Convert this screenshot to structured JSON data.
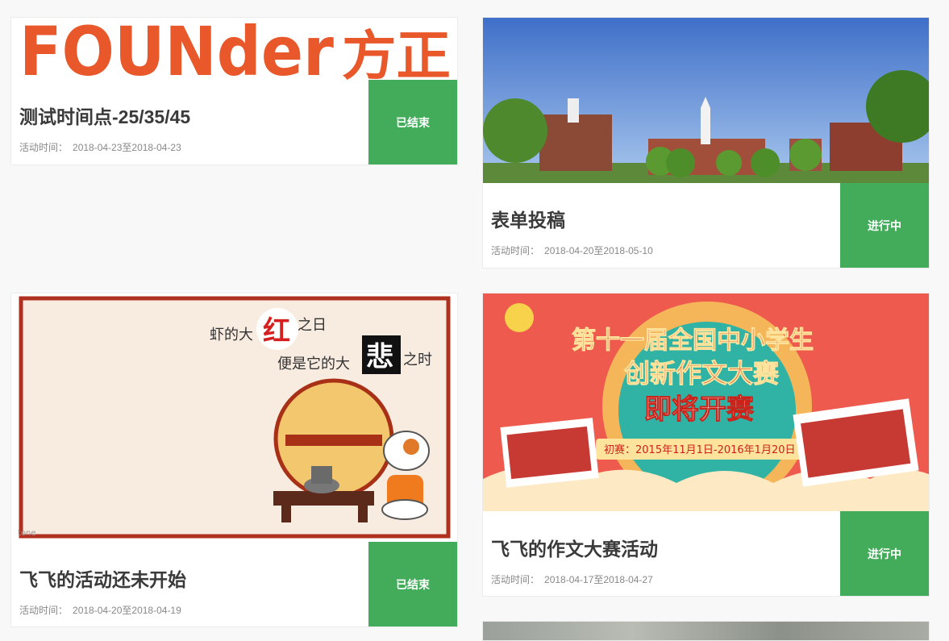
{
  "cards": [
    {
      "title": "测试时间点-25/35/45",
      "time_label": "活动时间：",
      "time_range": "2018-04-23至2018-04-23",
      "status": "已结束",
      "image": {
        "logo_text": "FOUNder",
        "logo_cn": "方正",
        "logo_color": "#e8582a"
      }
    },
    {
      "title": "表单投稿",
      "time_label": "活动时间：",
      "time_range": "2018-04-20至2018-05-10",
      "status": "进行中",
      "image": {
        "subject": "campus-panorama-icon"
      }
    },
    {
      "title": "飞飞的活动还未开始",
      "time_label": "活动时间：",
      "time_range": "2018-04-20至2018-04-19",
      "status": "已结束",
      "image": {
        "line1_a": "虾的大",
        "line1_big": "红",
        "line1_b": "之日",
        "line2_a": "便是它的大",
        "line2_big": "悲",
        "line2_b": "之时",
        "corner_mark": "tone"
      }
    },
    {
      "title": "飞飞的作文大赛活动",
      "time_label": "活动时间：",
      "time_range": "2018-04-17至2018-04-27",
      "status": "进行中",
      "image": {
        "headline1": "第十一届全国中小学生",
        "headline2": "创新作文大赛",
        "headline3": "即将开赛",
        "schedule": "初赛：2015年11月1日-2016年1月20日"
      }
    }
  ],
  "colors": {
    "status_green": "#43ac5b",
    "page_bg": "#f8f8f8"
  }
}
